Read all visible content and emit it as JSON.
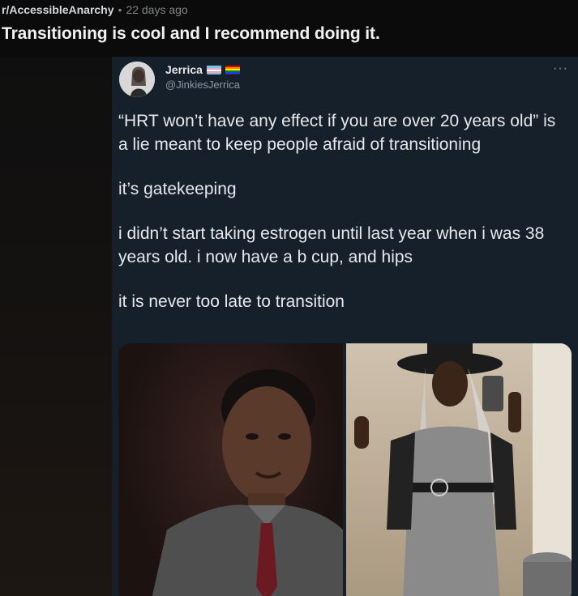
{
  "post": {
    "subreddit": "r/AccessibleAnarchy",
    "separator": "•",
    "time": "22 days ago",
    "title": "Transitioning is cool and I recommend doing it."
  },
  "tweet": {
    "name": "Jerrica",
    "handle": "@JinkiesJerrica",
    "more_icon": "more-icon",
    "more_glyph": "···",
    "paragraphs": [
      "“HRT won’t have any effect if you are over 20 years old” is a lie meant to keep people afraid of transitioning",
      "it’s gatekeeping",
      "i didn’t start taking estrogen until last year when i was 38 years old. i now have a b cup, and hips",
      "it is never too late to transition"
    ]
  },
  "colors": {
    "page_bg": "#0b0b0b",
    "tweet_bg": "#15202b",
    "tweet_text": "#e7e9ea",
    "handle": "#8b98a5"
  }
}
